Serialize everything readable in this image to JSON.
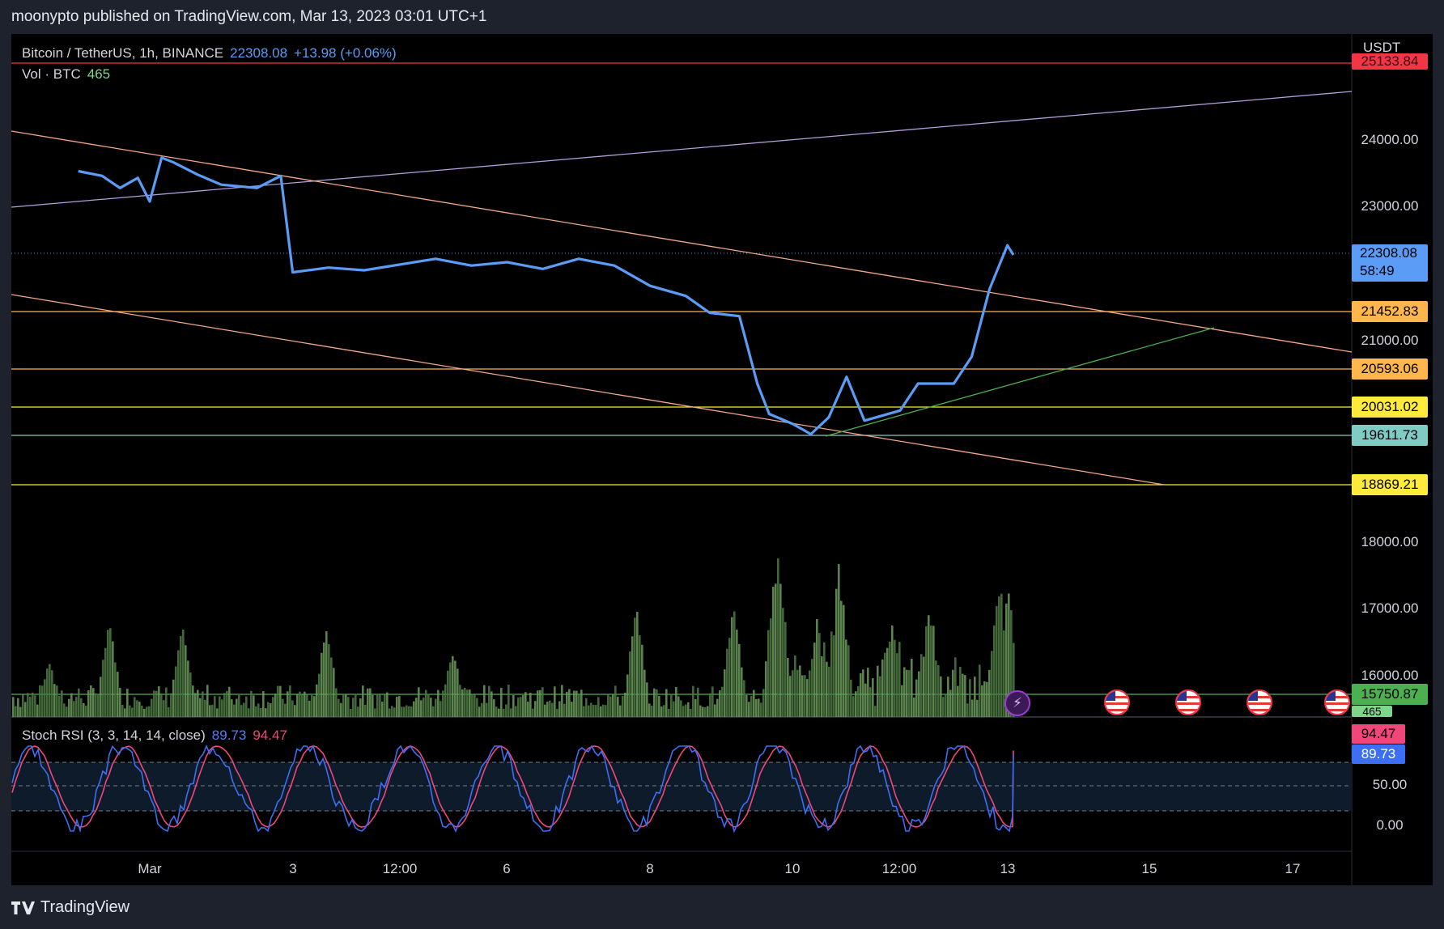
{
  "header": {
    "text": "moonypto published on TradingView.com, Mar 13, 2023 03:01 UTC+1"
  },
  "legend": {
    "symbol": "Bitcoin / TetherUS, 1h, BINANCE",
    "price": "22308.08",
    "change": "+13.98 (+0.06%)",
    "volume_label": "Vol · BTC",
    "volume_value": "465"
  },
  "stoch": {
    "label": "Stoch RSI (3, 3, 14, 14, close)",
    "k": "89.73",
    "d": "94.47"
  },
  "axis": {
    "currency": "USDT",
    "y_labels": [
      "24000.00",
      "23000.00",
      "21000.00",
      "18000.00",
      "17000.00",
      "16000.00"
    ],
    "stoch_labels": [
      "50.00",
      "0.00"
    ],
    "x_labels": [
      "Mar",
      "3",
      "12:00",
      "6",
      "8",
      "10",
      "12:00",
      "13",
      "15",
      "17"
    ]
  },
  "price_tags": [
    {
      "label": "25133.84",
      "color": "#f23645"
    },
    {
      "label": "21452.83",
      "color": "#ffb74d"
    },
    {
      "label": "20593.06",
      "color": "#ffb74d"
    },
    {
      "label": "20031.02",
      "color": "#ffeb3b"
    },
    {
      "label": "19611.73",
      "color": "#80cbc4"
    },
    {
      "label": "18869.21",
      "color": "#ffeb3b"
    },
    {
      "label": "15750.87",
      "color": "#4caf50"
    }
  ],
  "current_tag": {
    "price": "22308.08",
    "countdown": "58:49",
    "color": "#5b9cf6"
  },
  "volume_tag": {
    "label": "465",
    "color": "#7fd68b"
  },
  "stoch_tags": {
    "d": "94.47",
    "k": "89.73",
    "d_color": "#f0477a",
    "k_color": "#3d6ff5"
  },
  "icons": {
    "event": "lightning-icon",
    "flags": "us-flag-icon"
  },
  "footer": {
    "brand": "TradingView"
  },
  "chart_data": {
    "type": "line",
    "title": "Bitcoin / TetherUS, 1h, BINANCE",
    "x_ticks": [
      "Mar",
      "3",
      "12:00",
      "6",
      "8",
      "10",
      "12:00",
      "13",
      "15",
      "17"
    ],
    "series": [
      {
        "name": "Bitcoin / TetherUS",
        "color": "#5b9cf6",
        "points": [
          [
            "Feb 28 00:00",
            23550
          ],
          [
            "Feb 28 08:00",
            23480
          ],
          [
            "Feb 28 14:00",
            23300
          ],
          [
            "Feb 28 20:00",
            23450
          ],
          [
            "Mar 1 00:00",
            23100
          ],
          [
            "Mar 1 04:00",
            23750
          ],
          [
            "Mar 1 08:00",
            23680
          ],
          [
            "Mar 1 16:00",
            23500
          ],
          [
            "Mar 2 00:00",
            23350
          ],
          [
            "Mar 2 12:00",
            23300
          ],
          [
            "Mar 2 20:00",
            23480
          ],
          [
            "Mar 3 00:00",
            22050
          ],
          [
            "Mar 3 12:00",
            22120
          ],
          [
            "Mar 4 00:00",
            22080
          ],
          [
            "Mar 5 00:00",
            22250
          ],
          [
            "Mar 5 12:00",
            22150
          ],
          [
            "Mar 6 00:00",
            22200
          ],
          [
            "Mar 6 12:00",
            22100
          ],
          [
            "Mar 7 00:00",
            22250
          ],
          [
            "Mar 7 12:00",
            22150
          ],
          [
            "Mar 8 00:00",
            21850
          ],
          [
            "Mar 8 12:00",
            21700
          ],
          [
            "Mar 8 20:00",
            21450
          ],
          [
            "Mar 9 06:00",
            21400
          ],
          [
            "Mar 9 12:00",
            20400
          ],
          [
            "Mar 9 16:00",
            19950
          ],
          [
            "Mar 10 00:00",
            19800
          ],
          [
            "Mar 10 06:00",
            19650
          ],
          [
            "Mar 10 12:00",
            19900
          ],
          [
            "Mar 10 18:00",
            20500
          ],
          [
            "Mar 11 00:00",
            19850
          ],
          [
            "Mar 11 12:00",
            20000
          ],
          [
            "Mar 11 18:00",
            20400
          ],
          [
            "Mar 12 06:00",
            20400
          ],
          [
            "Mar 12 12:00",
            20800
          ],
          [
            "Mar 12 18:00",
            21800
          ],
          [
            "Mar 13 00:00",
            22450
          ],
          [
            "Mar 13 02:00",
            22308.08
          ]
        ]
      }
    ],
    "horizontal_levels": [
      25133.84,
      21452.83,
      20593.06,
      20031.02,
      19611.73,
      18869.21,
      15750.87
    ],
    "volume": {
      "name": "Vol · BTC",
      "last": 465
    },
    "stoch_rsi": {
      "k_last": 89.73,
      "d_last": 94.47,
      "bands": [
        80,
        50,
        20
      ]
    },
    "y_ticks": [
      24000,
      23000,
      21000,
      18000,
      17000,
      16000
    ]
  }
}
